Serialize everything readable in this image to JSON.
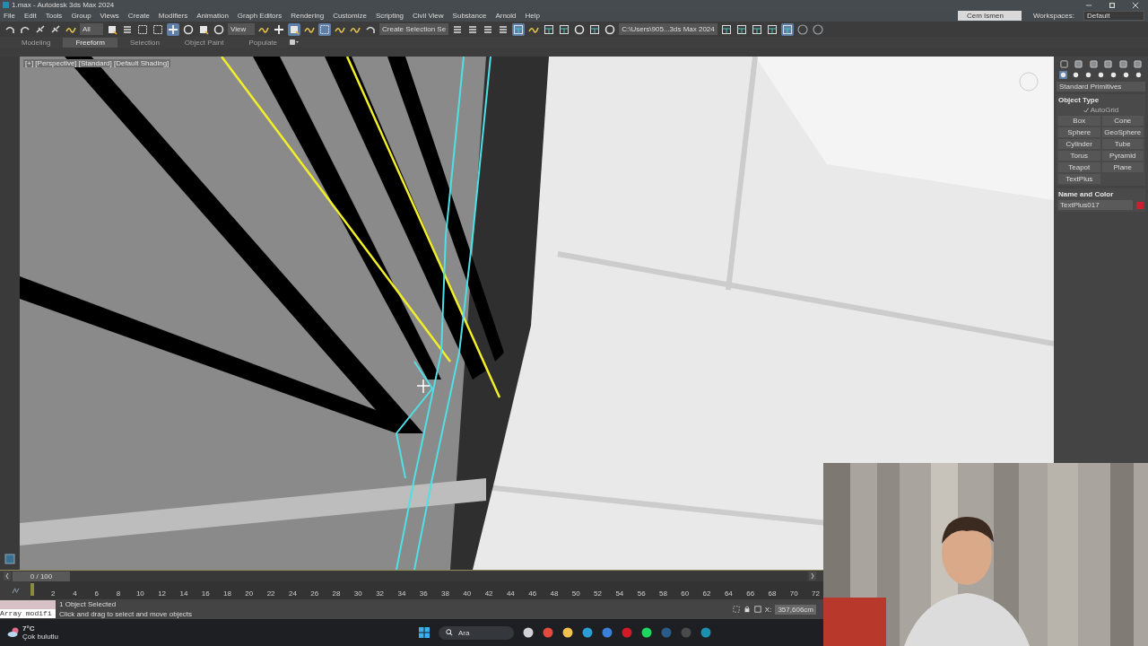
{
  "window": {
    "title": "1.max - Autodesk 3ds Max 2024"
  },
  "menu": [
    "File",
    "Edit",
    "Tools",
    "Group",
    "Views",
    "Create",
    "Modifiers",
    "Animation",
    "Graph Editors",
    "Rendering",
    "Customize",
    "Scripting",
    "Civil View",
    "Substance",
    "Arnold",
    "Help"
  ],
  "account": {
    "user": "Cem Ismen",
    "workspaces_label": "Workspaces:",
    "workspace": "Default"
  },
  "toolbar": {
    "selection_filter": "All",
    "reference_coord": "View",
    "selection_set": "Create Selection Se",
    "project_path": "C:\\Users\\905...3ds Max 2024"
  },
  "ribbon_tabs": [
    {
      "label": "Modeling",
      "selected": false
    },
    {
      "label": "Freeform",
      "selected": true
    },
    {
      "label": "Selection",
      "selected": false
    },
    {
      "label": "Object Paint",
      "selected": false
    },
    {
      "label": "Populate",
      "selected": false
    }
  ],
  "viewport": {
    "label": "[+] [Perspective] [Standard] [Default Shading]"
  },
  "command_panel": {
    "category": "Standard Primitives",
    "object_type_title": "Object Type",
    "autogrid": {
      "label": "AutoGrid",
      "checked": true,
      "disabled": true
    },
    "buttons": [
      "Box",
      "Cone",
      "Sphere",
      "GeoSphere",
      "Cylinder",
      "Tube",
      "Torus",
      "Pyramid",
      "Teapot",
      "Plane",
      "TextPlus"
    ],
    "name_color_title": "Name and Color",
    "object_name": "TextPlus017"
  },
  "time_slider": {
    "position": "0 / 100",
    "level": 0
  },
  "track": {
    "ticks": [
      "2",
      "4",
      "6",
      "8",
      "10",
      "12",
      "14",
      "16",
      "18",
      "20",
      "22",
      "24",
      "26",
      "28",
      "30",
      "32",
      "34",
      "36",
      "38",
      "40",
      "42",
      "44",
      "46",
      "48",
      "50",
      "52",
      "54",
      "56",
      "58",
      "60",
      "62",
      "64",
      "66",
      "68",
      "70",
      "72"
    ]
  },
  "status": {
    "script": "Array modifi",
    "selected": "1 Object Selected",
    "prompt": "Click and drag to select and move objects",
    "x_label": "X:",
    "x_value": "357,606cm"
  },
  "taskbar": {
    "temperature": "7°C",
    "weather": "Çok bulutlu",
    "search": "Ara"
  }
}
